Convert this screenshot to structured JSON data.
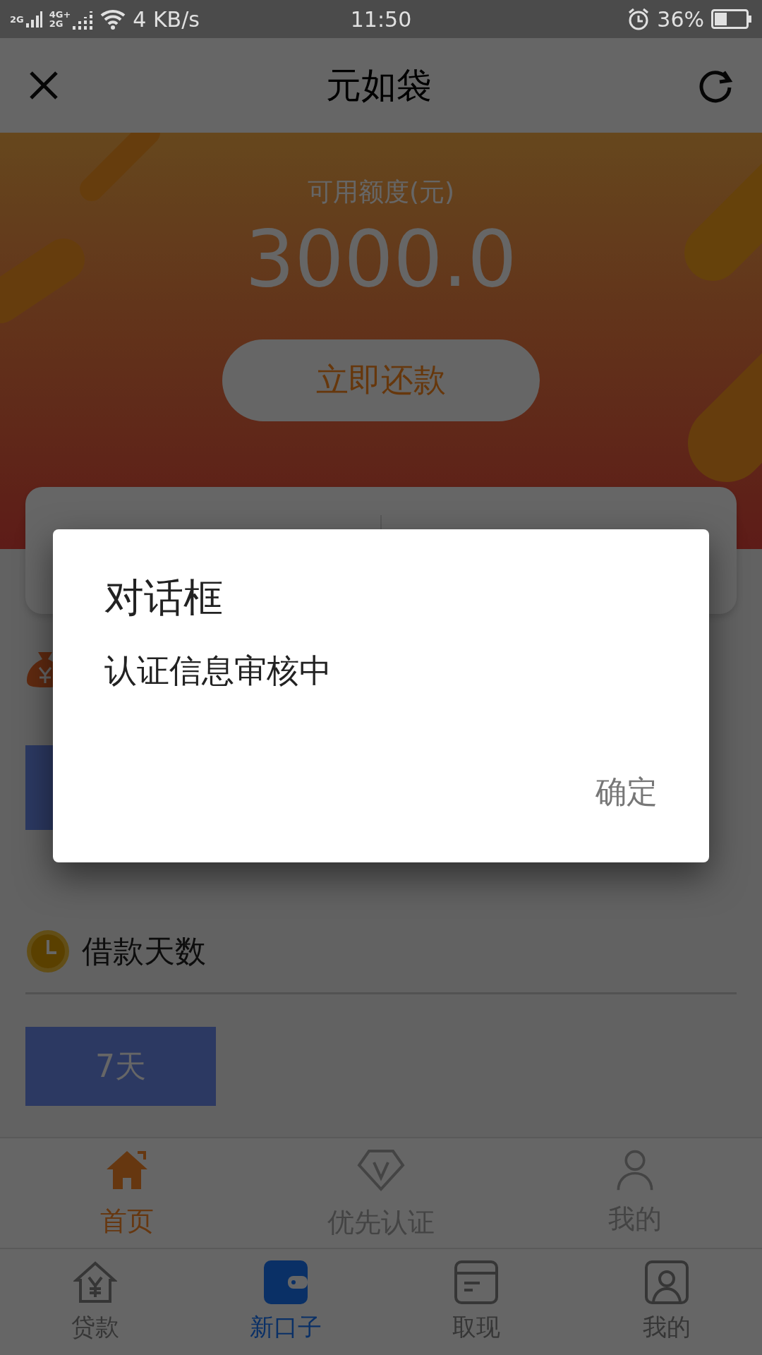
{
  "status_bar": {
    "sim_labels": [
      "2G",
      "4G+",
      "2G"
    ],
    "speed": "4 KB/s",
    "time": "11:50",
    "battery": "36%"
  },
  "title_bar": {
    "title": "元如袋"
  },
  "header": {
    "label": "可用额度(元)",
    "amount": "3000.0",
    "button": "立即还款"
  },
  "loan_days": {
    "title": "借款天数",
    "options": [
      {
        "label": "7天"
      }
    ]
  },
  "nav_primary": [
    {
      "label": "首页",
      "kind": "home",
      "selected": true
    },
    {
      "label": "优先认证",
      "kind": "badge",
      "selected": false
    },
    {
      "label": "我的",
      "kind": "person",
      "selected": false
    }
  ],
  "nav_secondary": [
    {
      "label": "贷款",
      "kind": "loan",
      "selected": false
    },
    {
      "label": "新口子",
      "kind": "wallet",
      "selected": true
    },
    {
      "label": "取现",
      "kind": "card",
      "selected": false
    },
    {
      "label": "我的",
      "kind": "profile",
      "selected": false
    }
  ],
  "dialog": {
    "title": "对话框",
    "message": "认证信息审核中",
    "button": "确定"
  }
}
